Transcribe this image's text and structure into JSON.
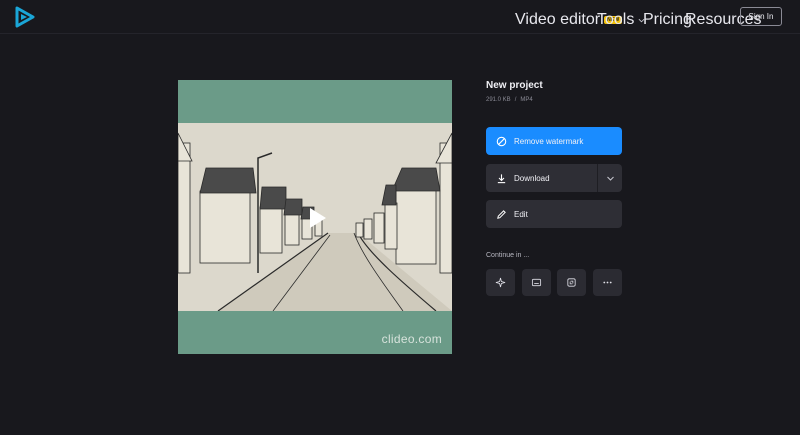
{
  "nav": {
    "video_editor": "Video editor",
    "new_badge": "NEW",
    "tools": "Tools",
    "pricing": "Pricing",
    "resources": "Resources",
    "sign_in": "Sign In"
  },
  "project": {
    "title": "New project",
    "size": "291.0 KB",
    "separator": "/",
    "format": "MP4"
  },
  "preview": {
    "watermark": "clideo.com"
  },
  "actions": {
    "remove_watermark": "Remove watermark",
    "download": "Download",
    "edit": "Edit"
  },
  "continue": {
    "label": "Continue in ...",
    "tools": [
      "sparkle-icon",
      "subtitles-icon",
      "crop-icon",
      "more-icon"
    ]
  },
  "colors": {
    "background": "#18181d",
    "accent": "#1a8cff",
    "badge": "#f5c20a",
    "preview_bg": "#6b9b88"
  }
}
